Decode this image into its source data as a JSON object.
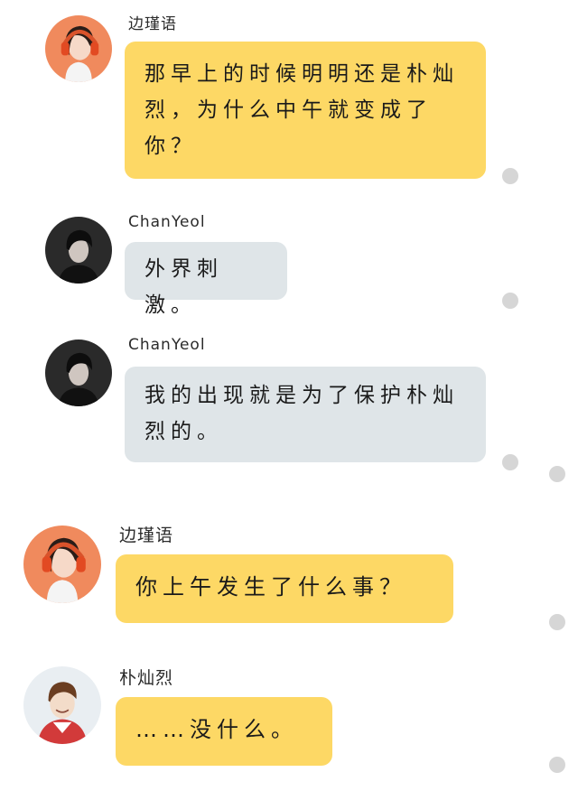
{
  "colors": {
    "bubble_yellow": "#fdd865",
    "bubble_gray": "#dfe5e8",
    "unread_dot": "#d6d6d6"
  },
  "messages": [
    {
      "sender": "边瑾语",
      "text": "那早上的时候明明还是朴灿烈，为什么中午就变成了你？",
      "avatar": "girl-with-orange-headphones-avatar",
      "bubble_color": "yellow"
    },
    {
      "sender": "ChanYeol",
      "text": "外界刺激。",
      "avatar": "dark-haired-man-avatar",
      "bubble_color": "gray"
    },
    {
      "sender": "ChanYeol",
      "text": "我的出现就是为了保护朴灿烈的。",
      "avatar": "dark-haired-man-avatar",
      "bubble_color": "gray"
    },
    {
      "sender": "边瑾语",
      "text": "你上午发生了什么事？",
      "avatar": "girl-with-orange-headphones-avatar",
      "bubble_color": "yellow"
    },
    {
      "sender": "朴灿烈",
      "text": "……没什么。",
      "avatar": "smiling-man-avatar",
      "bubble_color": "yellow"
    }
  ]
}
